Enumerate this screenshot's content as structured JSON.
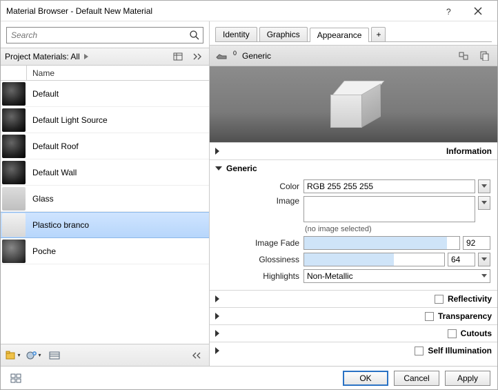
{
  "window": {
    "title": "Material Browser - Default New Material"
  },
  "search": {
    "placeholder": "Search"
  },
  "project_bar": {
    "label": "Project Materials: All"
  },
  "list": {
    "header": "Name",
    "items": [
      {
        "name": "Default",
        "thumb": "dark"
      },
      {
        "name": "Default Light Source",
        "thumb": "dark"
      },
      {
        "name": "Default Roof",
        "thumb": "dark"
      },
      {
        "name": "Default Wall",
        "thumb": "dark"
      },
      {
        "name": "Glass",
        "thumb": "glass"
      },
      {
        "name": "Plastico branco",
        "thumb": "white",
        "selected": true
      },
      {
        "name": "Poche",
        "thumb": "poche"
      }
    ]
  },
  "tabs": {
    "items": [
      "Identity",
      "Graphics",
      "Appearance"
    ],
    "active": 2,
    "plus": "+"
  },
  "generic_bar": {
    "badge": "0",
    "label": "Generic"
  },
  "sections": {
    "information": {
      "label": "Information",
      "open": false
    },
    "generic": {
      "label": "Generic",
      "open": true,
      "color_label": "Color",
      "color_value": "RGB 255 255 255",
      "image_label": "Image",
      "no_image": "(no image selected)",
      "image_fade_label": "Image Fade",
      "image_fade_value": "92",
      "image_fade_pct": 92,
      "glossiness_label": "Glossiness",
      "glossiness_value": "64",
      "glossiness_pct": 64,
      "highlights_label": "Highlights",
      "highlights_value": "Non-Metallic"
    },
    "reflectivity": {
      "label": "Reflectivity"
    },
    "transparency": {
      "label": "Transparency"
    },
    "cutouts": {
      "label": "Cutouts"
    },
    "self_illum": {
      "label": "Self Illumination"
    }
  },
  "footer": {
    "ok": "OK",
    "cancel": "Cancel",
    "apply": "Apply"
  }
}
